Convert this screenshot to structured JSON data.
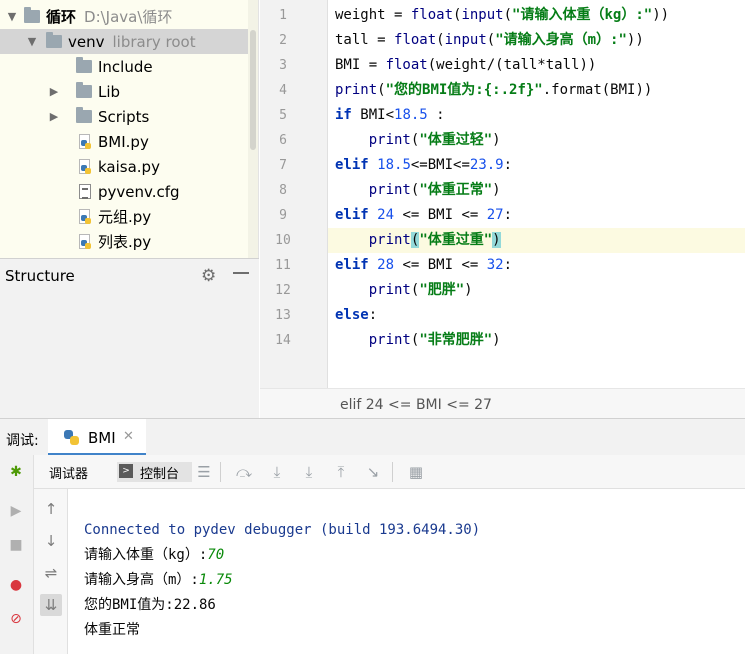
{
  "project": {
    "root": {
      "name": "循环",
      "path": "D:\\Java\\循环"
    },
    "venv": {
      "name": "venv",
      "tag": "library root"
    },
    "items": [
      {
        "label": "Include",
        "kind": "folder",
        "expandable": false
      },
      {
        "label": "Lib",
        "kind": "folder",
        "expandable": true
      },
      {
        "label": "Scripts",
        "kind": "folder",
        "expandable": true
      },
      {
        "label": "BMI.py",
        "kind": "python"
      },
      {
        "label": "kaisa.py",
        "kind": "python"
      },
      {
        "label": "pyvenv.cfg",
        "kind": "config"
      },
      {
        "label": "元组.py",
        "kind": "python"
      },
      {
        "label": "列表.py",
        "kind": "python"
      }
    ]
  },
  "structure": {
    "title": "Structure"
  },
  "editor": {
    "line_numbers": [
      "1",
      "2",
      "3",
      "4",
      "5",
      "6",
      "7",
      "8",
      "9",
      "10",
      "11",
      "12",
      "13",
      "14"
    ],
    "current_line": 10,
    "breadcrumb": "elif 24 <= BMI <= 27",
    "lines": [
      "weight = float(input(\"请输入体重（kg）:\"))",
      "tall = float(input(\"请输入身高（m）:\"))",
      "BMI = float(weight/(tall*tall))",
      "print(\"您的BMI值为:{:.2f}\".format(BMI))",
      "if BMI<18.5 :",
      "    print(\"体重过轻\")",
      "elif 18.5<=BMI<=23.9:",
      "    print(\"体重正常\")",
      "elif 24 <= BMI <= 27:",
      "    print(\"体重过重\")",
      "elif 28 <= BMI <= 32:",
      "    print(\"肥胖\")",
      "else:",
      "    print(\"非常肥胖\")"
    ]
  },
  "debug": {
    "title": "调试:",
    "tab_label": "BMI",
    "sub_tabs": {
      "debugger": "调试器",
      "console": "控制台"
    },
    "console_lines": [
      {
        "text": "Connected to pydev debugger (build 193.6494.30)",
        "style": "blue"
      },
      {
        "prompt": "请输入体重（kg）:",
        "input": "70"
      },
      {
        "prompt": "请输入身高（m）:",
        "input": "1.75"
      },
      {
        "text": "您的BMI值为:22.86",
        "style": "normal"
      },
      {
        "text": "体重正常",
        "style": "normal"
      }
    ]
  },
  "colors": {
    "keyword": "#0033b3",
    "string": "#067d17",
    "number": "#1750eb",
    "console_blue": "#1a3a8f",
    "console_input": "#0a8a0a",
    "tab_underline": "#4083c9",
    "project_bg": "#fdfdf0"
  }
}
